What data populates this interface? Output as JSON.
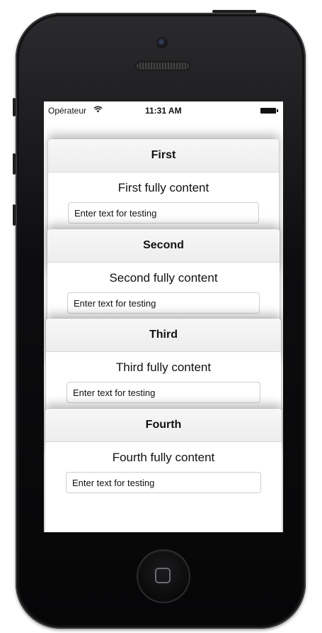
{
  "status_bar": {
    "carrier": "Opérateur",
    "wifi_icon": "wifi-icon",
    "time": "11:31 AM",
    "battery_icon": "battery-icon"
  },
  "cards": [
    {
      "title": "First",
      "content": "First fully content",
      "input_placeholder": "Enter text for testing"
    },
    {
      "title": "Second",
      "content": "Second fully content",
      "input_placeholder": "Enter text for testing"
    },
    {
      "title": "Third",
      "content": "Third fully content",
      "input_placeholder": "Enter text for testing"
    },
    {
      "title": "Fourth",
      "content": "Fourth fully content",
      "input_placeholder": "Enter text for testing"
    }
  ],
  "device": {
    "home_button_icon": "home-button-icon"
  }
}
